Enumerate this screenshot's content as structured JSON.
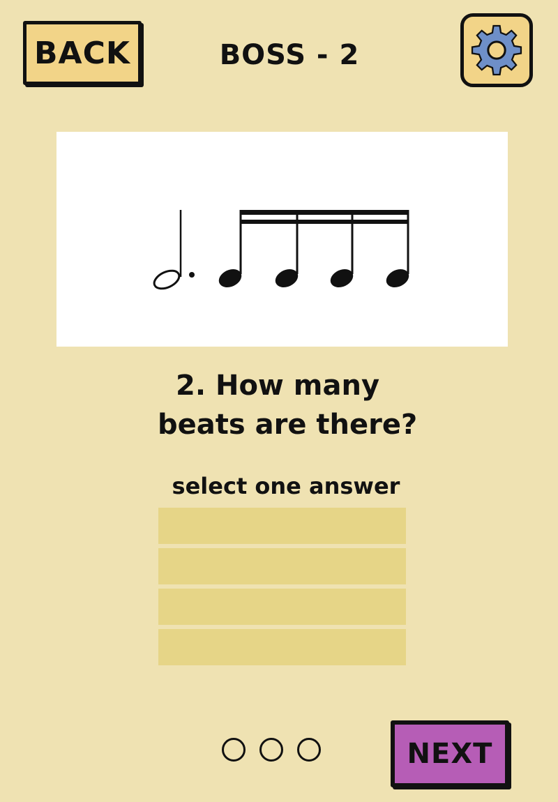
{
  "header": {
    "back_label": "BACK",
    "title": "BOSS - 2",
    "settings_icon": "gear-icon"
  },
  "question": {
    "number": "2.",
    "line1": "How many",
    "line2": "beats are there?"
  },
  "instructions": "select one answer",
  "answers": [
    "",
    "",
    "",
    ""
  ],
  "progress": {
    "total": 3,
    "completed": 0
  },
  "footer": {
    "next_label": "NEXT"
  },
  "colors": {
    "background": "#efe2b2",
    "button": "#f2d488",
    "gear": "#6e8fc8",
    "answer_option": "#e6d587",
    "next_button": "#b65db6"
  },
  "notation": {
    "notes": [
      "dotted-half-note",
      "quarter-note",
      "quarter-note",
      "quarter-note",
      "quarter-note"
    ]
  }
}
